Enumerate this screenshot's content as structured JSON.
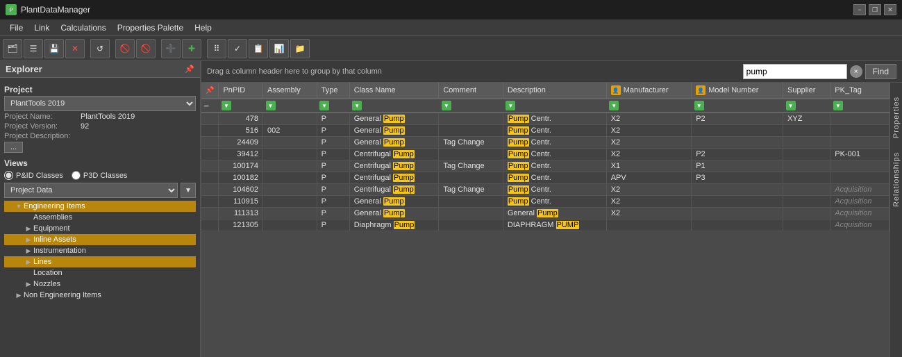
{
  "titlebar": {
    "title": "PlantDataManager",
    "icon": "P",
    "minimize": "−",
    "restore": "❐",
    "close": "✕"
  },
  "menubar": {
    "items": [
      "File",
      "Link",
      "Calculations",
      "Properties Palette",
      "Help"
    ]
  },
  "toolbar": {
    "buttons": [
      {
        "icon": "🗂",
        "name": "open"
      },
      {
        "icon": "☰",
        "name": "list"
      },
      {
        "icon": "💾",
        "name": "save"
      },
      {
        "icon": "✕",
        "name": "close"
      },
      {
        "icon": "↺",
        "name": "refresh"
      },
      {
        "icon": "⛔",
        "name": "block1"
      },
      {
        "icon": "⛔",
        "name": "block2"
      },
      {
        "icon": "➕",
        "name": "add"
      },
      {
        "icon": "✚",
        "name": "add2"
      },
      {
        "icon": "⠿",
        "name": "grid"
      },
      {
        "icon": "✓",
        "name": "check"
      },
      {
        "icon": "📋",
        "name": "clipboard"
      },
      {
        "icon": "📊",
        "name": "report"
      },
      {
        "icon": "📁",
        "name": "folder"
      }
    ]
  },
  "explorer": {
    "title": "Explorer",
    "pin_icon": "📌",
    "project_section": "Project",
    "project_select": "PlantTools 2019",
    "project_name_label": "Project Name:",
    "project_name_value": "PlantTools 2019",
    "project_version_label": "Project Version:",
    "project_version_value": "92",
    "project_description_label": "Project Description:",
    "project_description_btn": "...",
    "views_label": "Views",
    "view_pid": "P&ID Classes",
    "view_p3d": "P3D Classes",
    "project_data_label": "Project Data",
    "tree": {
      "items": [
        {
          "id": "engineering",
          "label": "Engineering Items",
          "indent": 1,
          "has_arrow": true,
          "expanded": true,
          "highlighted": true
        },
        {
          "id": "assemblies",
          "label": "Assemblies",
          "indent": 2,
          "has_arrow": false,
          "expanded": false
        },
        {
          "id": "equipment",
          "label": "Equipment",
          "indent": 2,
          "has_arrow": true,
          "expanded": false
        },
        {
          "id": "inline-assets",
          "label": "Inline Assets",
          "indent": 2,
          "has_arrow": true,
          "expanded": false,
          "highlighted": true
        },
        {
          "id": "instrumentation",
          "label": "Instrumentation",
          "indent": 2,
          "has_arrow": true,
          "expanded": false
        },
        {
          "id": "lines",
          "label": "Lines",
          "indent": 2,
          "has_arrow": true,
          "expanded": false,
          "highlighted": true
        },
        {
          "id": "location",
          "label": "Location",
          "indent": 2,
          "has_arrow": false,
          "expanded": false
        },
        {
          "id": "nozzles",
          "label": "Nozzles",
          "indent": 2,
          "has_arrow": true,
          "expanded": false
        },
        {
          "id": "non-engineering",
          "label": "Non Engineering Items",
          "indent": 1,
          "has_arrow": true,
          "expanded": false
        }
      ]
    }
  },
  "search": {
    "hint": "Drag a column header here to group by that column",
    "input_value": "pump",
    "input_placeholder": "pump",
    "clear_label": "×",
    "find_label": "Find"
  },
  "table": {
    "columns": [
      {
        "id": "pnpid",
        "label": "PnPID",
        "has_icon": false
      },
      {
        "id": "assembly",
        "label": "Assembly",
        "has_icon": false
      },
      {
        "id": "type",
        "label": "Type",
        "has_icon": false
      },
      {
        "id": "classname",
        "label": "Class Name",
        "has_icon": false
      },
      {
        "id": "comment",
        "label": "Comment",
        "has_icon": false
      },
      {
        "id": "description",
        "label": "Description",
        "has_icon": false
      },
      {
        "id": "manufacturer",
        "label": "Manufacturer",
        "has_icon": true
      },
      {
        "id": "modelnumber",
        "label": "Model Number",
        "has_icon": true
      },
      {
        "id": "supplier",
        "label": "Supplier",
        "has_icon": false
      },
      {
        "id": "pktag",
        "label": "PK_Tag",
        "has_icon": false
      }
    ],
    "rows": [
      {
        "pnpid": "478",
        "assembly": "",
        "type": "P",
        "classname": "General Pump",
        "comment": "",
        "description": "Pump Centr.",
        "manufacturer": "X2",
        "modelnumber": "P2",
        "supplier": "XYZ",
        "pktag": ""
      },
      {
        "pnpid": "516",
        "assembly": "002",
        "type": "P",
        "classname": "General Pump",
        "comment": "",
        "description": "Pump Centr.",
        "manufacturer": "X2",
        "modelnumber": "",
        "supplier": "",
        "pktag": ""
      },
      {
        "pnpid": "24409",
        "assembly": "",
        "type": "P",
        "classname": "General Pump",
        "comment": "Tag Change",
        "description": "Pump Centr.",
        "manufacturer": "X2",
        "modelnumber": "",
        "supplier": "",
        "pktag": ""
      },
      {
        "pnpid": "39412",
        "assembly": "",
        "type": "P",
        "classname": "Centrifugal Pump",
        "comment": "",
        "description": "Pump Centr.",
        "manufacturer": "X2",
        "modelnumber": "P2",
        "supplier": "",
        "pktag": "PK-001"
      },
      {
        "pnpid": "100174",
        "assembly": "",
        "type": "P",
        "classname": "Centrifugal Pump",
        "comment": "Tag Change",
        "description": "Pump Centr.",
        "manufacturer": "X1",
        "modelnumber": "P1",
        "supplier": "",
        "pktag": ""
      },
      {
        "pnpid": "100182",
        "assembly": "",
        "type": "P",
        "classname": "Centrifugal Pump",
        "comment": "",
        "description": "Pump Centr.",
        "manufacturer": "APV",
        "modelnumber": "P3",
        "supplier": "",
        "pktag": ""
      },
      {
        "pnpid": "104602",
        "assembly": "",
        "type": "P",
        "classname": "Centrifugal Pump",
        "comment": "Tag Change",
        "description": "Pump Centr.",
        "manufacturer": "X2",
        "modelnumber": "",
        "supplier": "",
        "pktag": "Acquisition"
      },
      {
        "pnpid": "110915",
        "assembly": "",
        "type": "P",
        "classname": "General Pump",
        "comment": "",
        "description": "Pump Centr.",
        "manufacturer": "X2",
        "modelnumber": "",
        "supplier": "",
        "pktag": "Acquisition"
      },
      {
        "pnpid": "111313",
        "assembly": "",
        "type": "P",
        "classname": "General Pump",
        "comment": "",
        "description": "General Pump",
        "manufacturer": "X2",
        "modelnumber": "",
        "supplier": "",
        "pktag": "Acquisition"
      },
      {
        "pnpid": "121305",
        "assembly": "",
        "type": "P",
        "classname": "Diaphragm Pump",
        "comment": "",
        "description": "DIAPHRAGM PUMP",
        "manufacturer": "",
        "modelnumber": "",
        "supplier": "",
        "pktag": "Acquisition"
      }
    ],
    "highlight_word": "Pump"
  },
  "right_sidebar": {
    "properties_label": "Properties",
    "relationships_label": "Relationships"
  },
  "arrow": {
    "color": "#7ec800"
  }
}
